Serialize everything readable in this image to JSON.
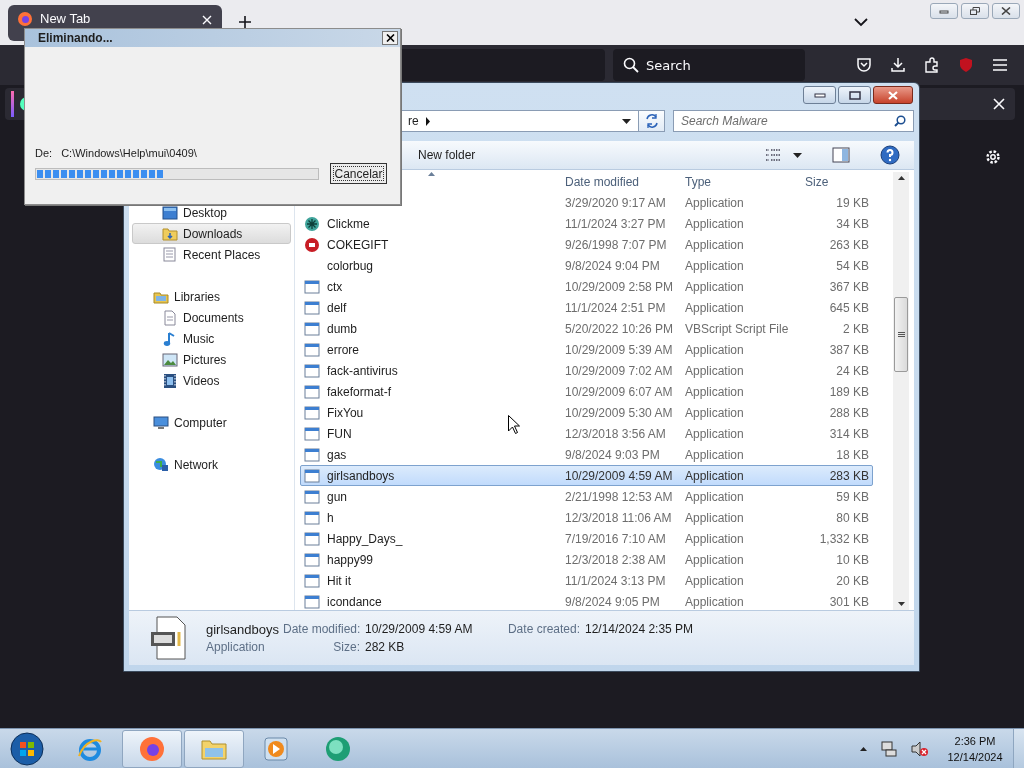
{
  "browser": {
    "tab": {
      "title": "New Tab"
    },
    "search": {
      "placeholder": "Search"
    }
  },
  "dialog": {
    "title": "Eliminando...",
    "from_label": "De:",
    "path": "C:\\Windows\\Help\\mui\\0409\\",
    "progress": {
      "level": 0.45
    },
    "cancel_button": "Cancelar"
  },
  "explorer": {
    "address": "re",
    "search": {
      "placeholder": "Search Malware"
    },
    "toolbar": {
      "new_folder": "New folder"
    },
    "sidebar": {
      "items": [
        {
          "children": [
            {
              "label": "Desktop",
              "selected": false
            },
            {
              "label": "Downloads",
              "selected": true
            },
            {
              "label": "Recent Places",
              "selected": false
            }
          ]
        },
        {
          "label": "Libraries",
          "selected": false,
          "children": [
            {
              "label": "Documents",
              "selected": false
            },
            {
              "label": "Music",
              "selected": false
            },
            {
              "label": "Pictures",
              "selected": false
            },
            {
              "label": "Videos",
              "selected": false
            }
          ]
        },
        {
          "label": "Computer",
          "selected": false
        },
        {
          "label": "Network",
          "selected": false
        }
      ]
    },
    "columns": [
      "Date modified",
      "Type",
      "Size"
    ],
    "rows": [
      {
        "icon": false,
        "date": "3/29/2020 9:17 AM",
        "type": "Application",
        "size": "19 KB",
        "selected": false
      },
      {
        "name": "Clickme",
        "icon": true,
        "date": "11/1/2024 3:27 PM",
        "type": "Application",
        "size": "34 KB",
        "selected": false
      },
      {
        "name": "COKEGIFT",
        "icon": true,
        "date": "9/26/1998 7:07 PM",
        "type": "Application",
        "size": "263 KB",
        "selected": false
      },
      {
        "name": "colorbug",
        "icon": false,
        "date": "9/8/2024 9:04 PM",
        "type": "Application",
        "size": "54 KB",
        "selected": false
      },
      {
        "name": "ctx",
        "icon": true,
        "date": "10/29/2009 2:58 PM",
        "type": "Application",
        "size": "367 KB",
        "selected": false
      },
      {
        "name": "delf",
        "icon": true,
        "date": "11/1/2024 2:51 PM",
        "type": "Application",
        "size": "645 KB",
        "selected": false
      },
      {
        "name": "dumb",
        "icon": true,
        "date": "5/20/2022 10:26 PM",
        "type": "VBScript Script File",
        "size": "2 KB",
        "selected": false
      },
      {
        "name": "errore",
        "icon": true,
        "date": "10/29/2009 5:39 AM",
        "type": "Application",
        "size": "387 KB",
        "selected": false
      },
      {
        "name": "fack-antivirus",
        "icon": true,
        "date": "10/29/2009 7:02 AM",
        "type": "Application",
        "size": "24 KB",
        "selected": false
      },
      {
        "name": "fakeformat-f",
        "icon": true,
        "date": "10/29/2009 6:07 AM",
        "type": "Application",
        "size": "189 KB",
        "selected": false
      },
      {
        "name": "FixYou",
        "icon": true,
        "date": "10/29/2009 5:30 AM",
        "type": "Application",
        "size": "288 KB",
        "selected": false
      },
      {
        "name": "FUN",
        "icon": true,
        "date": "12/3/2018 3:56 AM",
        "type": "Application",
        "size": "314 KB",
        "selected": false
      },
      {
        "name": "gas",
        "icon": true,
        "date": "9/8/2024 9:03 PM",
        "type": "Application",
        "size": "18 KB",
        "selected": false
      },
      {
        "name": "girlsandboys",
        "icon": true,
        "date": "10/29/2009 4:59 AM",
        "type": "Application",
        "size": "283 KB",
        "selected": true
      },
      {
        "name": "gun",
        "icon": true,
        "date": "2/21/1998 12:53 AM",
        "type": "Application",
        "size": "59 KB",
        "selected": false
      },
      {
        "name": "h",
        "icon": true,
        "date": "12/3/2018 11:06 AM",
        "type": "Application",
        "size": "80 KB",
        "selected": false
      },
      {
        "name": "Happy_Days_",
        "icon": true,
        "date": "7/19/2016 7:10 AM",
        "type": "Application",
        "size": "1,332 KB",
        "selected": false
      },
      {
        "name": "happy99",
        "icon": true,
        "date": "12/3/2018 2:38 AM",
        "type": "Application",
        "size": "10 KB",
        "selected": false
      },
      {
        "name": "Hit it",
        "icon": true,
        "date": "11/1/2024 3:13 PM",
        "type": "Application",
        "size": "20 KB",
        "selected": false
      },
      {
        "name": "icondance",
        "icon": true,
        "date": "9/8/2024 9:05 PM",
        "type": "Application",
        "size": "301 KB",
        "selected": false
      }
    ],
    "details": {
      "name": "girlsandboys",
      "type": "Application",
      "modified_label": "Date modified:",
      "modified": "10/29/2009 4:59 AM",
      "created_label": "Date created:",
      "created": "12/14/2024 2:35 PM",
      "size_label": "Size:",
      "size": "282 KB"
    }
  },
  "taskbar": {
    "apps": [
      {
        "active": false
      },
      {
        "active": true
      },
      {
        "active": true
      },
      {
        "active": false
      },
      {
        "active": false
      }
    ],
    "clock": {
      "time": "2:36 PM",
      "date": "12/14/2024"
    }
  }
}
